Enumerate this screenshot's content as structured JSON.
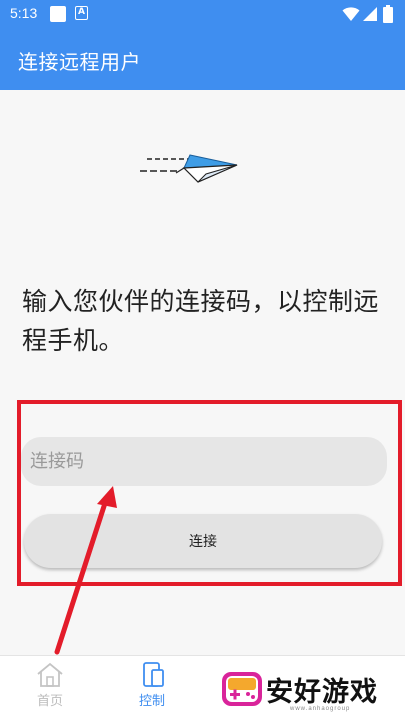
{
  "status_bar": {
    "time": "5:13",
    "notification_letter": "A"
  },
  "app_bar": {
    "title": "连接远程用户"
  },
  "instruction": "输入您伙伴的连接码，以控制远程手机。",
  "connection": {
    "placeholder": "连接码",
    "value": "",
    "connect_label": "连接"
  },
  "nav": {
    "items": [
      {
        "label": "首页",
        "icon": "home-icon",
        "active": false
      },
      {
        "label": "控制",
        "icon": "phone-control-icon",
        "active": true
      }
    ]
  },
  "watermark": {
    "text": "安好游戏",
    "subtext": "www.anhaogroup"
  },
  "colors": {
    "primary": "#3f8ef0",
    "highlight": "#e31c2a",
    "plane": "#3f9de6"
  }
}
